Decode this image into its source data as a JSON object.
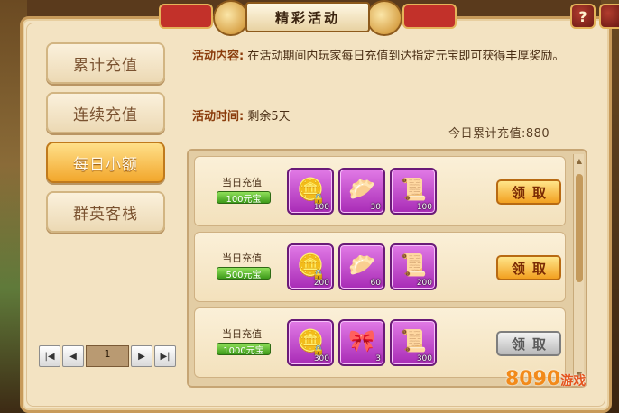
{
  "window": {
    "title": "精彩活动",
    "help_icon": "question-icon",
    "help_label": "?"
  },
  "tabs": [
    {
      "label": "累计充值",
      "active": false
    },
    {
      "label": "连续充值",
      "active": false
    },
    {
      "label": "每日小额",
      "active": true
    },
    {
      "label": "群英客栈",
      "active": false
    }
  ],
  "pager": {
    "first": "|◀",
    "prev": "◀",
    "page": "1",
    "next": "▶",
    "last": "▶|"
  },
  "activity": {
    "content_label": "活动内容:",
    "content_text": "在活动期间内玩家每日充值到达指定元宝即可获得丰厚奖励。",
    "time_label": "活动时间:",
    "time_text": "剩余5天",
    "total_text": "今日累计充值:880"
  },
  "rows": [
    {
      "label": "当日充值",
      "amount": "100元宝",
      "items": [
        {
          "icon": "gold-ingot-icon",
          "qty": "100",
          "locked": true
        },
        {
          "icon": "steamed-buns-icon",
          "qty": "30",
          "locked": false
        },
        {
          "icon": "scroll-icon",
          "qty": "100",
          "locked": false
        }
      ],
      "claim": "领取",
      "claim_enabled": true
    },
    {
      "label": "当日充值",
      "amount": "500元宝",
      "items": [
        {
          "icon": "gold-ingot-icon",
          "qty": "200",
          "locked": true
        },
        {
          "icon": "steamed-buns-icon",
          "qty": "60",
          "locked": false
        },
        {
          "icon": "scroll-icon",
          "qty": "200",
          "locked": false
        }
      ],
      "claim": "领取",
      "claim_enabled": true
    },
    {
      "label": "当日充值",
      "amount": "1000元宝",
      "items": [
        {
          "icon": "gold-ingot-icon",
          "qty": "300",
          "locked": true
        },
        {
          "icon": "ribbon-icon",
          "qty": "3",
          "locked": false
        },
        {
          "icon": "scroll-icon",
          "qty": "300",
          "locked": false
        }
      ],
      "claim": "领取",
      "claim_enabled": false
    }
  ],
  "watermark": {
    "text": "8090",
    "suffix": "游戏"
  }
}
